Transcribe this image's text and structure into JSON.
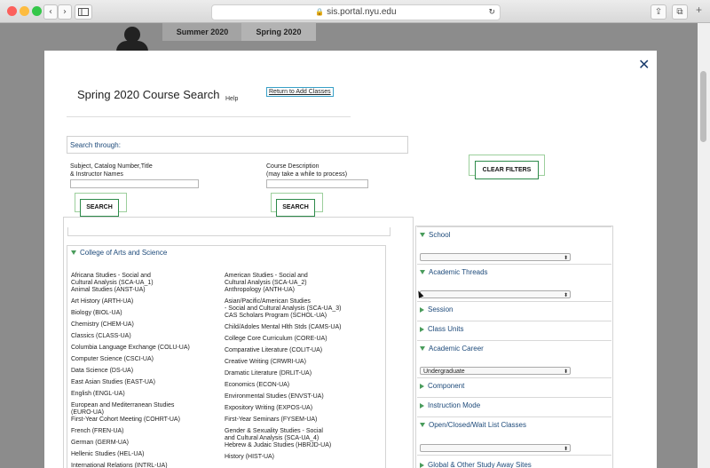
{
  "browser": {
    "url": "sis.portal.nyu.edu",
    "back": "‹",
    "forward": "›"
  },
  "colors": {
    "accent": "#1d4a7a",
    "button_border": "#2d8a4a",
    "link_border": "#39a0c7"
  },
  "tabs": [
    "Summer 2020",
    "Spring 2020"
  ],
  "modal": {
    "close": "✕",
    "title": "Spring 2020 Course Search",
    "help": "Help",
    "return_link": "Return to Add Classes",
    "search_through": "Search through:",
    "subject_label_1": "Subject, Catalog Number,Title",
    "subject_label_2": "& Instructor Names",
    "desc_label_1": "Course Description",
    "desc_label_2": "(may take a while to process)",
    "search_button": "SEARCH",
    "clear_filters": "CLEAR FILTERS",
    "college": "College of Arts and Science",
    "subjects_left": [
      "Africana Studies - Social and",
      "Cultural Analysis (SCA-UA_1)",
      "Animal Studies (ANST-UA)",
      "Art History (ARTH-UA)",
      "Biology (BIOL-UA)",
      "Chemistry (CHEM-UA)",
      "Classics (CLASS-UA)",
      "Columbia Language Exchange (COLU-UA)",
      "Computer Science (CSCI-UA)",
      "Data Science (DS-UA)",
      "East Asian Studies (EAST-UA)",
      "English (ENGL-UA)",
      "European and Mediterranean Studies",
      "(EURO-UA)",
      "First-Year Cohort Meeting (COHRT-UA)",
      "French (FREN-UA)",
      "German (GERM-UA)",
      "Hellenic Studies (HEL-UA)",
      "International Relations (INTRL-UA)"
    ],
    "subjects_right": [
      "American Studies - Social and",
      "Cultural Analysis (SCA-UA_2)",
      "Anthropology (ANTH-UA)",
      "Asian/Pacific/American Studies",
      "- Social and Cultural Analysis (SCA-UA_3)",
      "CAS Scholars Program (SCHOL-UA)",
      "Child/Adoles Mental Hlth Stds (CAMS-UA)",
      "College Core Curriculum (CORE-UA)",
      "Comparative Literature (COLIT-UA)",
      "Creative Writing (CRWRI-UA)",
      "Dramatic Literature (DRLIT-UA)",
      "Economics (ECON-UA)",
      "Environmental Studies (ENVST-UA)",
      "Expository Writing (EXPOS-UA)",
      "First-Year Seminars (FYSEM-UA)",
      "Gender & Sexuality Studies - Social",
      "and Cultural Analysis (SCA-UA_4)",
      "Hebrew & Judaic Studies (HBRJD-UA)",
      "History (HIST-UA)"
    ],
    "filters": {
      "school": "School",
      "academic_threads": "Academic Threads",
      "session": "Session",
      "class_units": "Class Units",
      "academic_career": "Academic Career",
      "career_value": "Undergraduate",
      "component": "Component",
      "instruction_mode": "Instruction Mode",
      "open_closed": "Open/Closed/Wait List Classes",
      "global": "Global & Other Study Away Sites"
    }
  }
}
